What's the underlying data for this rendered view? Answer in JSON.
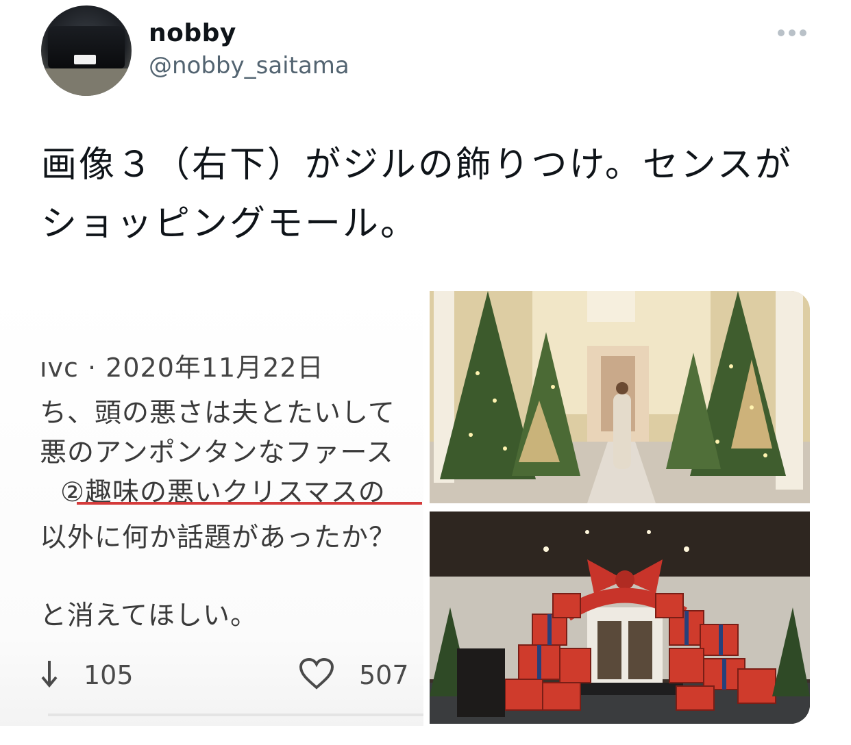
{
  "user": {
    "display_name": "nobby",
    "handle": "@nobby_saitama"
  },
  "tweet": {
    "text": "画像３（右下）がジルの飾りつけ。センスがショッピングモール。"
  },
  "media": {
    "screenshot": {
      "header": "ıvc · 2020年11月22日",
      "lines": [
        "ち、頭の悪さは夫とたいして",
        "悪のアンポンタンなファース",
        "②趣味の悪いクリスマスの",
        "以外に何か話題があったか？",
        "と消えてほしい。"
      ],
      "retweet_count": "105",
      "like_count": "507"
    }
  },
  "colors": {
    "handle": "#536471",
    "underline": "#d43a3a"
  }
}
